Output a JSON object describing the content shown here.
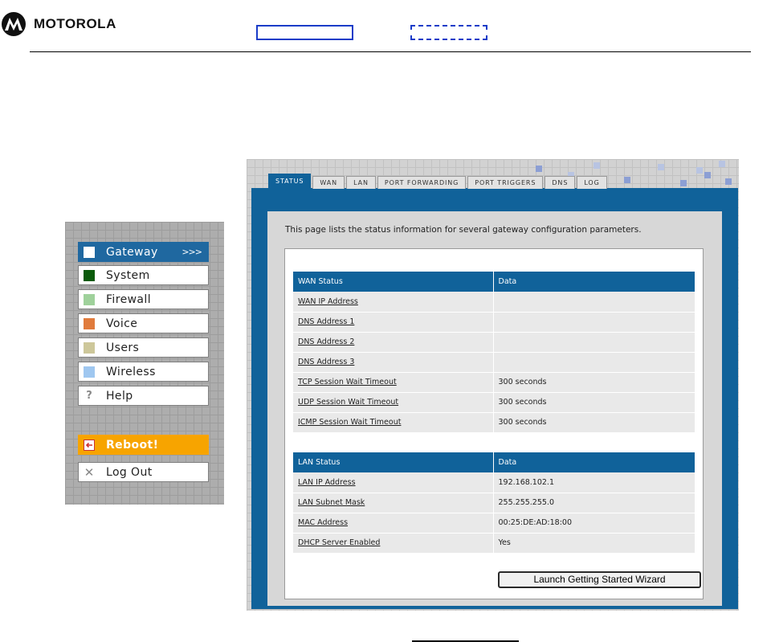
{
  "header": {
    "brand": "MOTOROLA"
  },
  "nav": {
    "items": [
      {
        "label": "Gateway",
        "color": "#ffffff",
        "state": "active",
        "arrows": ">>>"
      },
      {
        "label": "System",
        "color": "#0a5a0a"
      },
      {
        "label": "Firewall",
        "color": "#9fd19b"
      },
      {
        "label": "Voice",
        "color": "#e07b3c"
      },
      {
        "label": "Users",
        "color": "#cdc79a"
      },
      {
        "label": "Wireless",
        "color": "#9fc7f0"
      },
      {
        "label": "Help",
        "icon": "question-icon"
      },
      {
        "label": "Reboot!",
        "icon": "reboot-icon",
        "state": "warning"
      },
      {
        "label": "Log Out",
        "icon": "close-icon"
      }
    ]
  },
  "tabs": [
    "STATUS",
    "WAN",
    "LAN",
    "PORT FORWARDING",
    "PORT TRIGGERS",
    "DNS",
    "LOG"
  ],
  "active_tab": "STATUS",
  "intro": "This page lists the status information for several gateway configuration parameters.",
  "wan_table": {
    "headers": [
      "WAN Status",
      "Data"
    ],
    "rows": [
      [
        "WAN IP Address",
        ""
      ],
      [
        "DNS Address 1",
        ""
      ],
      [
        "DNS Address 2",
        ""
      ],
      [
        "DNS Address 3",
        ""
      ],
      [
        "TCP Session Wait Timeout",
        "300 seconds"
      ],
      [
        "UDP Session Wait Timeout",
        "300 seconds"
      ],
      [
        "ICMP Session Wait Timeout",
        "300 seconds"
      ]
    ]
  },
  "lan_table": {
    "headers": [
      "LAN Status",
      "Data"
    ],
    "rows": [
      [
        "LAN IP Address",
        "192.168.102.1"
      ],
      [
        "LAN Subnet Mask",
        "255.255.255.0"
      ],
      [
        "MAC Address",
        "00:25:DE:AD:18:00"
      ],
      [
        "DHCP Server Enabled",
        "Yes"
      ]
    ]
  },
  "wizard_button": "Launch Getting Started Wizard",
  "colors": {
    "accent": "#10629a",
    "reboot": "#f7a400"
  }
}
